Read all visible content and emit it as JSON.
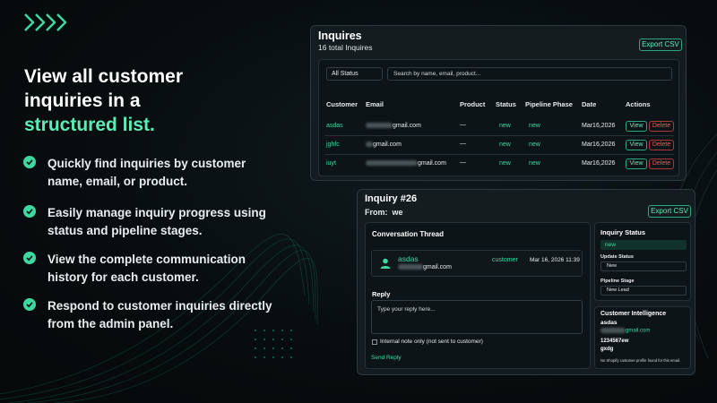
{
  "hero": {
    "title_line1": "View all customer",
    "title_line2": "inquiries in a",
    "title_line3": "structured list.",
    "features": [
      {
        "line1": "Quickly find inquiries by customer",
        "line2": "name, email, or product."
      },
      {
        "line1": "Easily manage inquiry progress using",
        "line2": "status and pipeline stages."
      },
      {
        "line1": "View the complete communication",
        "line2": "history for each customer."
      },
      {
        "line1": "Respond to customer inquiries directly",
        "line2": "from the admin panel."
      }
    ]
  },
  "inquires": {
    "title": "Inquires",
    "count": "16 total Inquires",
    "export": "Export CSV",
    "status_filter": "All Status",
    "search_placeholder": "Search by name, email, product...",
    "columns": [
      "Customer",
      "Email",
      "Product",
      "Status",
      "Pipeline Phase",
      "Date",
      "Actions"
    ],
    "rows": [
      {
        "customer": "asdas",
        "email": "gmail.com",
        "product": "—",
        "status": "new",
        "phase": "new",
        "date": "Mar16,2026",
        "view": "View",
        "delete": "Delete"
      },
      {
        "customer": "jghfc",
        "email": "gmail.com",
        "product": "—",
        "status": "new",
        "phase": "new",
        "date": "Mar16,2026",
        "view": "View",
        "delete": "Delete"
      },
      {
        "customer": "iuyt",
        "email": "gmail.com",
        "product": "—",
        "status": "new",
        "phase": "new",
        "date": "Mar16,2026",
        "view": "View",
        "delete": "Delete"
      }
    ]
  },
  "detail": {
    "title": "Inquiry #26",
    "from_label": "From:",
    "from_value": "we",
    "export": "Export CSV",
    "thread_title": "Conversation Thread",
    "message": {
      "name": "asdas",
      "email": "gmail.com",
      "role": "customer",
      "time": "Mar 16, 2026 11:39"
    },
    "reply_label": "Reply",
    "reply_placeholder": "Type your reply here...",
    "internal_note": "Internal note only (not sent to customer)",
    "send": "Send Reply",
    "status_panel": {
      "title": "Inquiry Status",
      "badge": "new",
      "update_label": "Update Status",
      "update_value": "New",
      "pipeline_label": "Pipeline Stage",
      "pipeline_value": "New Lead"
    },
    "intel_panel": {
      "title": "Customer Intelligence",
      "name": "asdas",
      "email": "gmail.com",
      "phone": "1234567ew",
      "extra": "gxdg",
      "note": "No Shopify customer profile found for this email."
    }
  },
  "colors": {
    "accent": "#3fd8a0",
    "danger": "#ef5a5a",
    "background": "#070c0e",
    "card": "#141c20"
  },
  "icons": [
    "chevrons-right-icon",
    "check-circle-icon",
    "user-icon"
  ]
}
